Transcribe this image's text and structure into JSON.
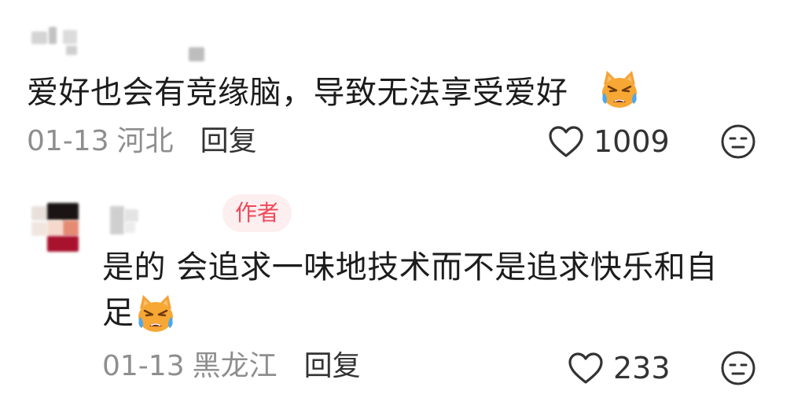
{
  "comments": [
    {
      "text": "爱好也会有竞缘脑，导致无法享受爱好",
      "date": "01-13",
      "region": "河北",
      "reply_label": "回复",
      "likes": "1009",
      "emoji": "crying-cat-emoji"
    },
    {
      "badge": "作者",
      "text_line1": "是的 会追求一味地技术而不是追求快乐和自",
      "text_line2": "足",
      "date": "01-13",
      "region": "黑龙江",
      "reply_label": "回复",
      "likes": "233",
      "emoji": "crying-cat-emoji"
    }
  ],
  "icons": {
    "like": "heart-outline-icon",
    "dislike": "unamused-face-icon"
  },
  "colors": {
    "badge_text": "#f04858",
    "badge_bg": "#fdeef0",
    "meta_gray": "#8e8e8e"
  }
}
